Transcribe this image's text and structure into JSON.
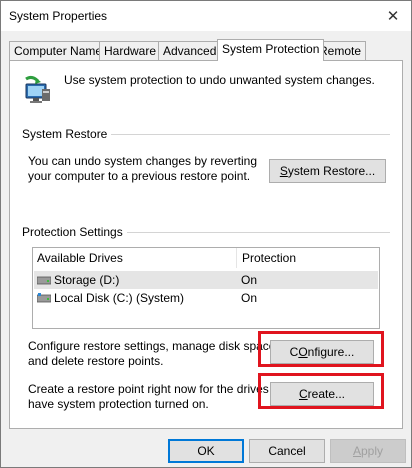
{
  "window": {
    "title": "System Properties",
    "close_glyph": "✕"
  },
  "tabs": [
    {
      "label": "Computer Name"
    },
    {
      "label": "Hardware"
    },
    {
      "label": "Advanced"
    },
    {
      "label": "System Protection",
      "active": true
    },
    {
      "label": "Remote"
    }
  ],
  "intro": {
    "text": "Use system protection to undo unwanted system changes.",
    "icon": "system-protection-icon"
  },
  "system_restore": {
    "heading": "System Restore",
    "description_line1": "You can undo system changes by reverting",
    "description_line2": "your computer to a previous restore point.",
    "button_label_first": "S",
    "button_label_rest": "ystem Restore..."
  },
  "protection": {
    "heading": "Protection Settings",
    "columns": [
      "Available Drives",
      "Protection"
    ],
    "rows": [
      {
        "drive": "Storage (D:)",
        "protection": "On",
        "icon": "drive-icon"
      },
      {
        "drive": "Local Disk (C:) (System)",
        "protection": "On",
        "icon": "system-drive-icon"
      }
    ],
    "configure_line1": "Configure restore settings, manage disk space,",
    "configure_line2": "and delete restore points.",
    "configure_button_first": "O",
    "configure_button_before": "C",
    "configure_button_rest": "nfigure...",
    "create_line1": "Create a restore point right now for the drives that",
    "create_line2": "have system protection turned on.",
    "create_button_first": "C",
    "create_button_rest": "reate..."
  },
  "footer": {
    "ok": "OK",
    "cancel": "Cancel",
    "apply_first": "A",
    "apply_rest": "pply"
  },
  "colors": {
    "highlight": "#e0141e",
    "accent": "#0078d7"
  }
}
